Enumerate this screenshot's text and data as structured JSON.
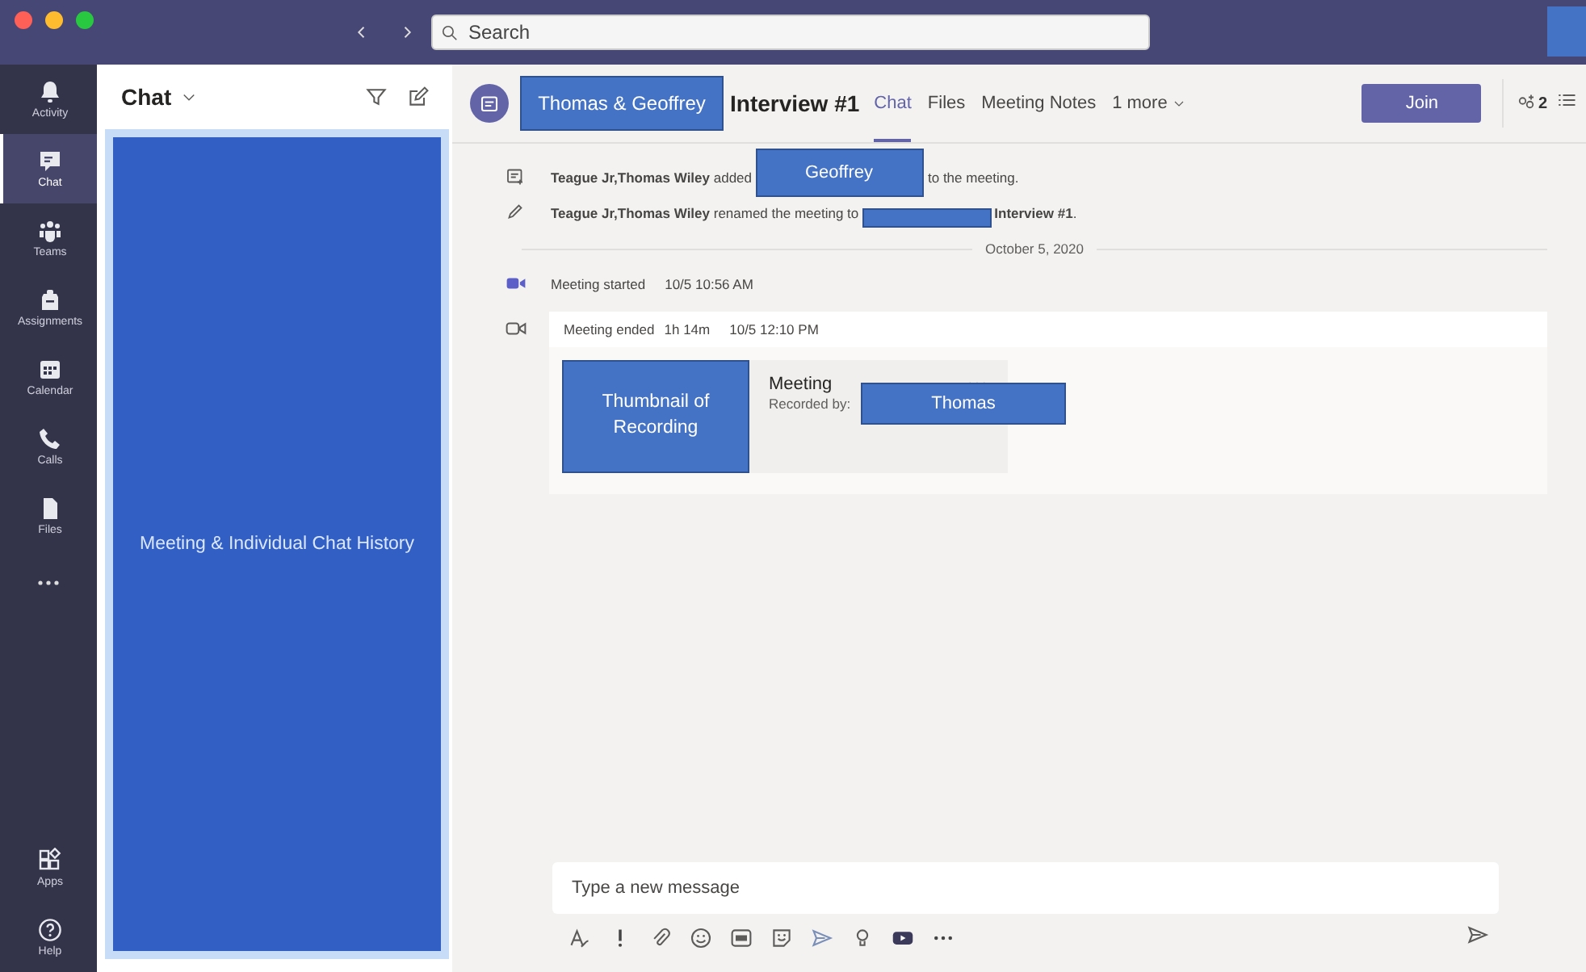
{
  "title_bar": {
    "search": {
      "placeholder": "Search"
    }
  },
  "rail": {
    "items": [
      {
        "kind": "activity",
        "label": "Activity",
        "selected": false
      },
      {
        "kind": "chat",
        "label": "Chat",
        "selected": true
      },
      {
        "kind": "teams",
        "label": "Teams",
        "selected": false
      },
      {
        "kind": "assignments",
        "label": "Assignments",
        "selected": false
      },
      {
        "kind": "calendar",
        "label": "Calendar",
        "selected": false
      },
      {
        "kind": "calls",
        "label": "Calls",
        "selected": false
      },
      {
        "kind": "files",
        "label": "Files",
        "selected": false
      }
    ],
    "bottom_items": [
      {
        "kind": "apps",
        "label": "Apps",
        "selected": false
      },
      {
        "kind": "help",
        "label": "Help",
        "selected": false
      }
    ]
  },
  "chat_panel": {
    "title": "Chat",
    "history_placeholder": "Meeting & Individual Chat History"
  },
  "header": {
    "name_redaction": "Thomas & Geoffrey",
    "title": "Interview #1",
    "tabs": [
      {
        "label": "Chat",
        "selected": true
      },
      {
        "label": "Files",
        "selected": false
      },
      {
        "label": "Meeting Notes",
        "selected": false
      },
      {
        "label": "1 more",
        "selected": false
      }
    ],
    "join_button": "Join",
    "participant_count": "2"
  },
  "events": [
    {
      "kind": "added",
      "text": "**Teague Jr,Thomas Wiley** added",
      "redaction": "Geoffrey",
      "rest": "to the meeting."
    },
    {
      "kind": "renamed",
      "text": "**Teague Jr,Thomas Wiley** renamed the meeting to",
      "rest": "**Interview #1**."
    }
  ],
  "date_divider": "October 5, 2020",
  "meeting_started": {
    "label": "Meeting started",
    "time": "10/5 10:56 AM"
  },
  "meeting_ended": {
    "label": "Meeting ended",
    "duration": "1h 14m",
    "time": "10/5 12:10 PM",
    "thumbnail": "Thumbnail of Recording",
    "recording_title": "Meeting",
    "recorded_by": "Recorded by:",
    "recorder_redaction": "Thomas"
  },
  "composer": {
    "placeholder": "Type a new message"
  }
}
